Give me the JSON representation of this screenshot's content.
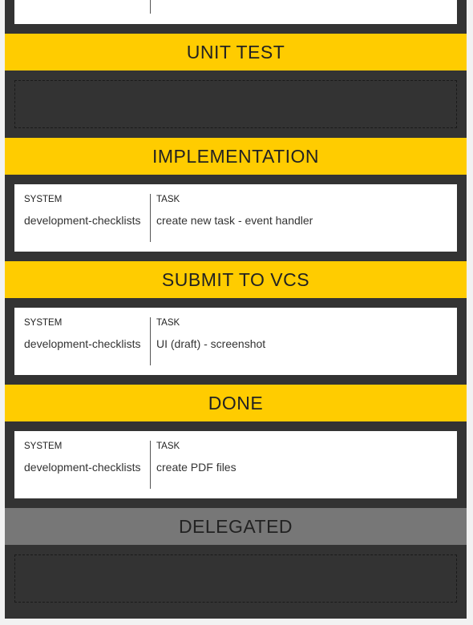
{
  "columns": {
    "system_label": "SYSTEM",
    "task_label": "TASK"
  },
  "sections": [
    {
      "title": "UNIT TEST",
      "cards": []
    },
    {
      "title": "IMPLEMENTATION",
      "cards": [
        {
          "system": "development-checklists",
          "task": "create new task - event handler"
        }
      ]
    },
    {
      "title": "SUBMIT TO VCS",
      "cards": [
        {
          "system": "development-checklists",
          "task": "UI (draft) - screenshot"
        }
      ]
    },
    {
      "title": "DONE",
      "cards": [
        {
          "system": "development-checklists",
          "task": "create PDF files"
        }
      ]
    },
    {
      "title": "DELEGATED",
      "cards": []
    }
  ],
  "colors": {
    "header_active": "#ffcc00",
    "header_delegated": "#777777",
    "board_background": "#333333"
  }
}
